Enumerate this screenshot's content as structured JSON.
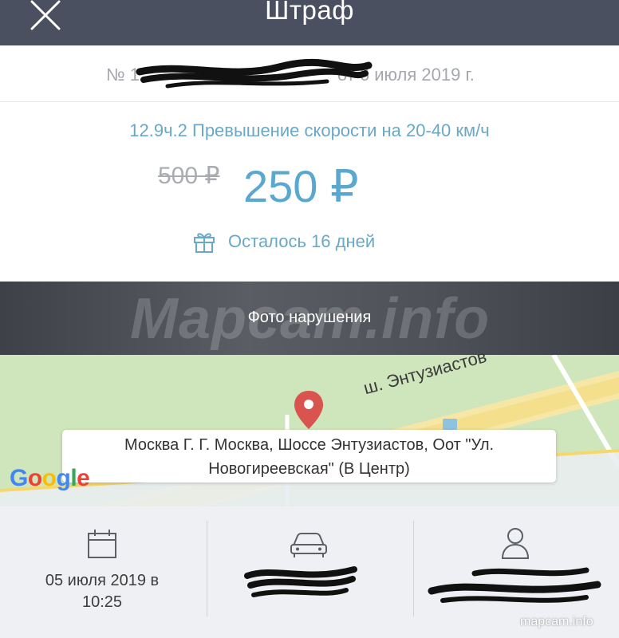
{
  "header": {
    "title": "Штраф",
    "close_icon": "close-icon"
  },
  "fine": {
    "number_prefix": "№ 1",
    "number_suffix": "от 6 июля 2019 г.",
    "article": "12.9ч.2 Превышение скорости на 20-40 км/ч",
    "old_price": "500 ₽",
    "new_price": "250 ₽",
    "days_left": "Осталось 16 дней",
    "gift_icon": "gift-icon"
  },
  "photo": {
    "label": "Фото нарушения",
    "watermark": "Mapcam.info"
  },
  "map": {
    "road_name": "ш. Энтузиастов",
    "address_line1": "Москва Г.   Г. Москва, Шоссе Энтузиастов, Оот \"Ул.",
    "address_line2": "Новогиреевская\" (В Центр)",
    "provider": "Google",
    "pin_icon": "map-pin-icon"
  },
  "details": {
    "date_line1": "05 июля 2019 в",
    "date_line2": "10:25",
    "calendar_icon": "calendar-icon",
    "car_icon": "car-icon",
    "person_icon": "person-icon"
  },
  "site": {
    "label": "mapcam.info"
  },
  "colors": {
    "header_bg": "#4a5060",
    "accent_blue": "#5aa8cf",
    "map_green": "#cfe6bc"
  }
}
